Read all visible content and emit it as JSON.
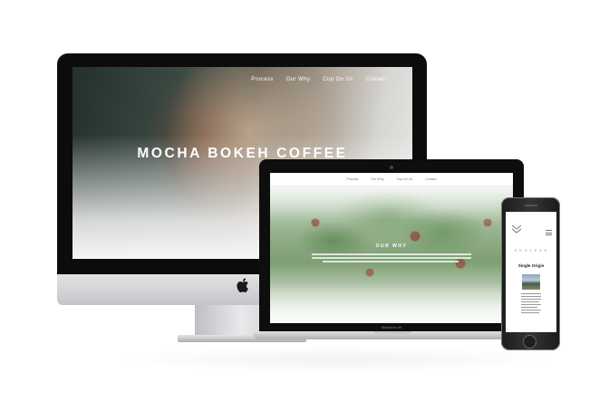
{
  "imac": {
    "nav_items": [
      "Process",
      "Our Why",
      "Cup On Us",
      "Contact"
    ],
    "hero_title": "MOCHA BOKEH COFFEE"
  },
  "macbook": {
    "nav_items": [
      "Process",
      "Our Why",
      "Cup On Us",
      "Contact"
    ],
    "section_heading": "OUR WHY",
    "brand_label": "MacBook Air"
  },
  "iphone": {
    "brand": "P R O C E S S",
    "section_heading": "Single Origin"
  },
  "colors": {
    "device_black": "#0c0c0c",
    "aluminum": "#c3c5c8",
    "page_background": "#ffffff"
  }
}
